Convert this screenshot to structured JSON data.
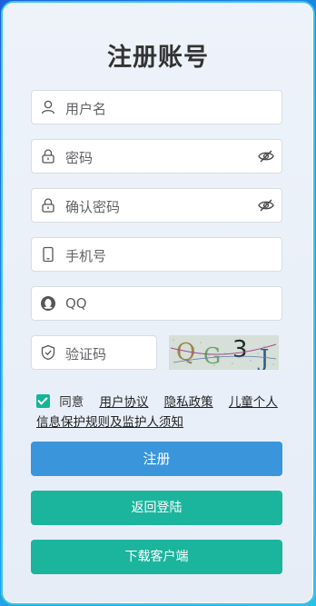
{
  "title": "注册账号",
  "fields": {
    "username": {
      "placeholder": "用户名",
      "icon": "user-icon"
    },
    "password": {
      "placeholder": "密码",
      "icon": "lock-icon",
      "toggle_icon": "eye-icon"
    },
    "confirm_password": {
      "placeholder": "确认密码",
      "icon": "lock-icon",
      "toggle_icon": "eye-icon"
    },
    "phone": {
      "placeholder": "手机号",
      "icon": "phone-icon"
    },
    "qq": {
      "placeholder": "QQ",
      "icon": "qq-icon"
    },
    "captcha": {
      "placeholder": "验证码",
      "icon": "shield-icon"
    }
  },
  "captcha_image": {
    "text": "QG3J"
  },
  "agreement": {
    "prefix": "同意",
    "user_agreement": "用户协议",
    "privacy_policy": "隐私政策",
    "children_policy": "儿童个人信息保护规则及监护人须知",
    "checked": true
  },
  "buttons": {
    "register": "注册",
    "back_login": "返回登陆",
    "download": "下载客户端"
  },
  "colors": {
    "primary": "#3a95db",
    "accent": "#1bb59d",
    "checkbox": "#13b597"
  }
}
